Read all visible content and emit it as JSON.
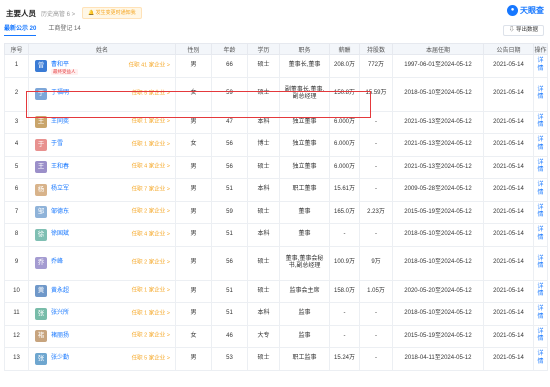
{
  "header": {
    "title": "主要人员",
    "history": "历史高管 6 >",
    "notice": "发生变更时通知我",
    "brand": "天眼查"
  },
  "tabs": [
    {
      "label": "最新公示 20",
      "active": true
    },
    {
      "label": "工商登记 14",
      "active": false
    }
  ],
  "export_label": "导出数据",
  "columns": [
    "序号",
    "姓名",
    "性别",
    "年龄",
    "学历",
    "职务",
    "薪酬",
    "持股数",
    "本届任期",
    "公告日期",
    "操作"
  ],
  "rows": [
    {
      "no": "1",
      "initial": "曾",
      "name": "曹和平",
      "terms": "任职 41 家企业 >",
      "tag": "最终受益人",
      "gender": "男",
      "age": "66",
      "edu": "硕士",
      "role": "董事长,董事",
      "salary": "208.0万",
      "shares": "772万",
      "term": "1997-06-01至2024-05-12",
      "date": "2021-05-14",
      "action": "详情",
      "color": "#3a7bd5",
      "photo": true
    },
    {
      "no": "2",
      "initial": "于",
      "name": "于福明",
      "terms": "任职 5 家企业 >",
      "gender": "女",
      "age": "59",
      "edu": "硕士",
      "role": "副董事长,董事,副总经理",
      "salary": "150.8万",
      "shares": "15.59万",
      "term": "2018-05-10至2024-05-12",
      "date": "2021-05-14",
      "action": "详情",
      "color": "#7da6d8"
    },
    {
      "no": "3",
      "initial": "王",
      "name": "王同奕",
      "terms": "任职 1 家企业 >",
      "gender": "男",
      "age": "47",
      "edu": "本科",
      "role": "独立董事",
      "salary": "6.000万",
      "shares": "-",
      "term": "2021-05-13至2024-05-12",
      "date": "2021-05-14",
      "action": "详情",
      "color": "#c9a56b"
    },
    {
      "no": "4",
      "initial": "于",
      "name": "于雪",
      "terms": "任职 1 家企业 >",
      "gender": "女",
      "age": "56",
      "edu": "博士",
      "role": "独立董事",
      "salary": "6.000万",
      "shares": "-",
      "term": "2021-05-13至2024-05-12",
      "date": "2021-05-14",
      "action": "详情",
      "color": "#e8918f"
    },
    {
      "no": "5",
      "initial": "王",
      "name": "王和春",
      "terms": "任职 4 家企业 >",
      "gender": "男",
      "age": "56",
      "edu": "硕士",
      "role": "独立董事",
      "salary": "6.000万",
      "shares": "-",
      "term": "2021-05-13至2024-05-12",
      "date": "2021-05-14",
      "action": "详情",
      "color": "#9b8fc9"
    },
    {
      "no": "6",
      "initial": "杨",
      "name": "杨立军",
      "terms": "任职 7 家企业 >",
      "gender": "男",
      "age": "51",
      "edu": "本科",
      "role": "职工董事",
      "salary": "15.61万",
      "shares": "-",
      "term": "2009-05-28至2024-05-12",
      "date": "2021-05-14",
      "action": "详情",
      "color": "#d8b38a"
    },
    {
      "no": "7",
      "initial": "邹",
      "name": "邹德东",
      "terms": "任职 2 家企业 >",
      "gender": "男",
      "age": "59",
      "edu": "硕士",
      "role": "董事",
      "salary": "165.0万",
      "shares": "2.23万",
      "term": "2015-05-19至2024-05-12",
      "date": "2021-05-14",
      "action": "详情",
      "color": "#8fb3d9"
    },
    {
      "no": "8",
      "initial": "徐",
      "name": "徐国斌",
      "terms": "任职 4 家企业 >",
      "gender": "男",
      "age": "51",
      "edu": "本科",
      "role": "董事",
      "salary": "-",
      "shares": "-",
      "term": "2018-05-10至2024-05-12",
      "date": "2021-05-14",
      "action": "详情",
      "color": "#7fbfb3"
    },
    {
      "no": "9",
      "initial": "乔",
      "name": "乔峰",
      "terms": "任职 2 家企业 >",
      "gender": "男",
      "age": "56",
      "edu": "硕士",
      "role": "董事,董事会秘书,副总经理",
      "salary": "100.9万",
      "shares": "9万",
      "term": "2018-05-10至2024-05-12",
      "date": "2021-05-14",
      "action": "详情",
      "color": "#a49bd1"
    },
    {
      "no": "10",
      "initial": "黄",
      "name": "黄永超",
      "terms": "任职 1 家企业 >",
      "gender": "男",
      "age": "51",
      "edu": "硕士",
      "role": "监事会主席",
      "salary": "158.0万",
      "shares": "1.05万",
      "term": "2020-05-20至2024-05-12",
      "date": "2021-05-14",
      "action": "详情",
      "color": "#6f98c9"
    },
    {
      "no": "11",
      "initial": "张",
      "name": "张兴所",
      "terms": "任职 1 家企业 >",
      "gender": "男",
      "age": "51",
      "edu": "本科",
      "role": "监事",
      "salary": "-",
      "shares": "-",
      "term": "2018-05-10至2024-05-12",
      "date": "2021-05-14",
      "action": "详情",
      "color": "#78bca9"
    },
    {
      "no": "12",
      "initial": "褚",
      "name": "褚丽扬",
      "terms": "任职 2 家企业 >",
      "gender": "女",
      "age": "46",
      "edu": "大专",
      "role": "监事",
      "salary": "-",
      "shares": "-",
      "term": "2015-05-19至2024-05-12",
      "date": "2021-05-14",
      "action": "详情",
      "color": "#c7a47e"
    },
    {
      "no": "13",
      "initial": "张",
      "name": "张少勤",
      "terms": "任职 5 家企业 >",
      "gender": "男",
      "age": "53",
      "edu": "硕士",
      "role": "职工监事",
      "salary": "15.24万",
      "shares": "-",
      "term": "2018-04-11至2024-05-12",
      "date": "2021-05-14",
      "action": "详情",
      "color": "#6ea6cf"
    }
  ]
}
